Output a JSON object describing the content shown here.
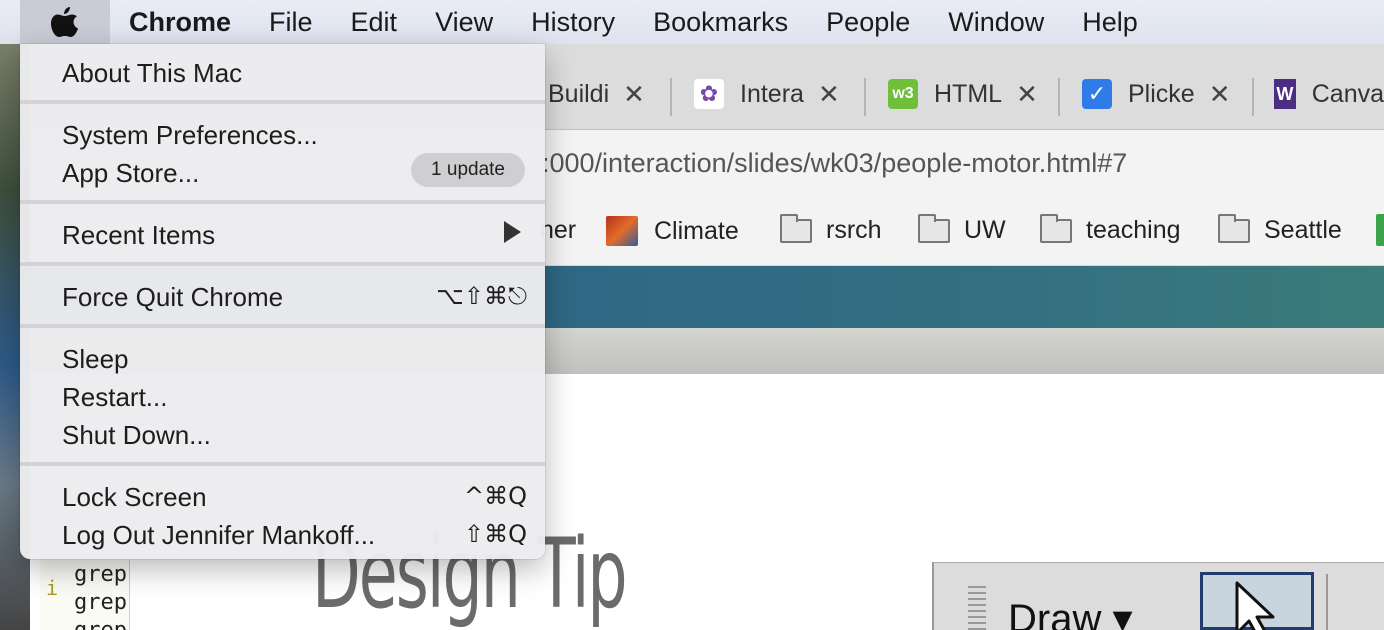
{
  "menubar": {
    "items": [
      "Chrome",
      "File",
      "Edit",
      "View",
      "History",
      "Bookmarks",
      "People",
      "Window",
      "Help"
    ]
  },
  "tabs": [
    {
      "label": "Buildi",
      "close": "✕",
      "color": "#4a7bd0"
    },
    {
      "label": "Intera",
      "close": "✕",
      "color": "#7a4aa8"
    },
    {
      "label": "HTML",
      "close": "✕",
      "color": "#6fbf3a"
    },
    {
      "label": "Plicke",
      "close": "✕",
      "color": "#2f7be8"
    },
    {
      "label": "Canva",
      "color": "#4b2e83"
    }
  ],
  "url": {
    "text": ":000/interaction/slides/wk03/people-motor.html#7"
  },
  "bookmarks": [
    {
      "label": "ner",
      "icon": "none"
    },
    {
      "label": "Climate",
      "icon": "image-icon"
    },
    {
      "label": "rsrch",
      "icon": "folder-icon"
    },
    {
      "label": "UW",
      "icon": "folder-icon"
    },
    {
      "label": "teaching",
      "icon": "folder-icon"
    },
    {
      "label": "Seattle",
      "icon": "folder-icon"
    }
  ],
  "apple_menu": {
    "about": "About This Mac",
    "system_prefs": "System Preferences...",
    "app_store": "App Store...",
    "app_store_badge": "1 update",
    "recent_items": "Recent Items",
    "force_quit": "Force Quit Chrome",
    "force_quit_shortcut": "⌥⇧⌘⎋",
    "sleep": "Sleep",
    "restart": "Restart...",
    "shut_down": "Shut Down...",
    "lock_screen": "Lock Screen",
    "lock_screen_shortcut": "^⌘Q",
    "log_out": "Log Out Jennifer Mankoff...",
    "log_out_shortcut": "⇧⌘Q"
  },
  "page": {
    "heading": "Design Tip",
    "terminal_lines": [
      "grep",
      "grep",
      "grep"
    ],
    "terminal_prefix": "i",
    "draw_label": "Draw ▾"
  }
}
